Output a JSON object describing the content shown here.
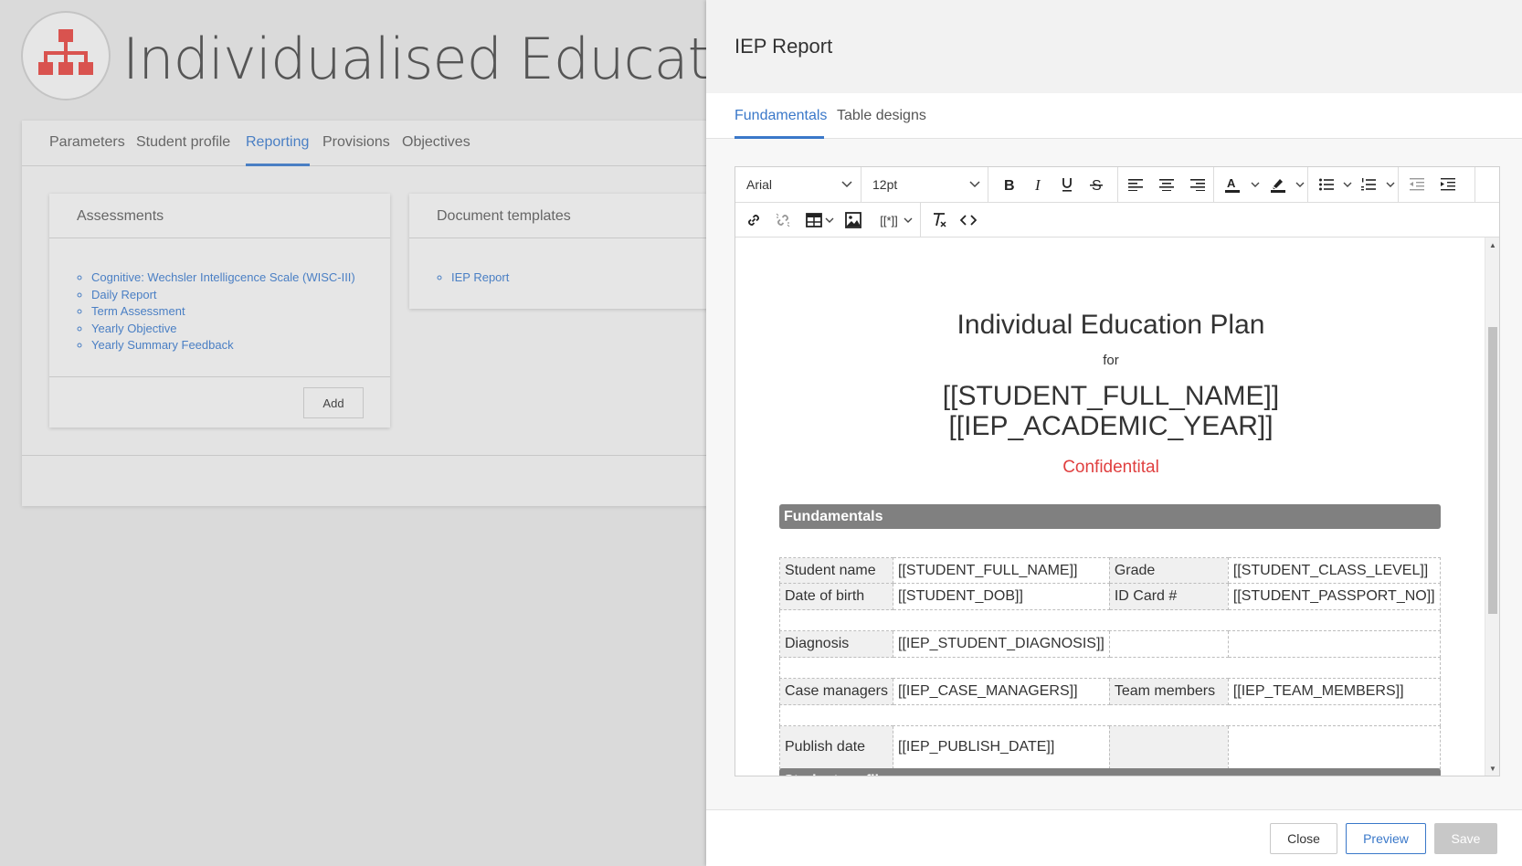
{
  "app": {
    "title": "Individualised Education Pl",
    "tabs": [
      "Parameters",
      "Student profile",
      "Reporting",
      "Provisions",
      "Objectives"
    ],
    "active_tab": "Reporting"
  },
  "assessments": {
    "title": "Assessments",
    "items": [
      "Cognitive: Wechsler Intelligcence Scale (WISC-III)",
      "Daily Report",
      "Term Assessment",
      "Yearly Objective",
      "Yearly Summary Feedback"
    ],
    "add_label": "Add"
  },
  "templates": {
    "title": "Document templates",
    "items": [
      "IEP Report"
    ]
  },
  "drawer": {
    "title": "IEP Report",
    "tabs": [
      "Fundamentals",
      "Table designs"
    ],
    "active_tab": "Fundamentals"
  },
  "toolbar": {
    "font_family": "Arial",
    "font_size": "12pt",
    "placeholder_menu": "[[*]]"
  },
  "document": {
    "heading": "Individual Education Plan",
    "for": "for",
    "name_placeholder": "[[STUDENT_FULL_NAME]]",
    "year_placeholder": "[[IEP_ACADEMIC_YEAR]]",
    "confidential": "Confidentital",
    "section_fundamentals": "Fundamentals",
    "section_next": "Student profile",
    "rows": {
      "student_name_label": "Student name",
      "student_name_value": "[[STUDENT_FULL_NAME]]",
      "grade_label": "Grade",
      "grade_value": "[[STUDENT_CLASS_LEVEL]]",
      "dob_label": "Date of birth",
      "dob_value": "[[STUDENT_DOB]]",
      "id_label": "ID Card #",
      "id_value": "[[STUDENT_PASSPORT_NO]]",
      "diagnosis_label": "Diagnosis",
      "diagnosis_value": "[[IEP_STUDENT_DIAGNOSIS]]",
      "case_label": "Case managers",
      "case_value": "[[IEP_CASE_MANAGERS]]",
      "team_label": "Team members",
      "team_value": "[[IEP_TEAM_MEMBERS]]",
      "publish_label": "Publish date",
      "publish_value": "[[IEP_PUBLISH_DATE]]"
    }
  },
  "footer": {
    "close": "Close",
    "preview": "Preview",
    "save": "Save"
  },
  "colors": {
    "accent": "#3a78c9",
    "logo": "#d9534f",
    "confidential": "#e04040",
    "section_bar": "#808080"
  }
}
